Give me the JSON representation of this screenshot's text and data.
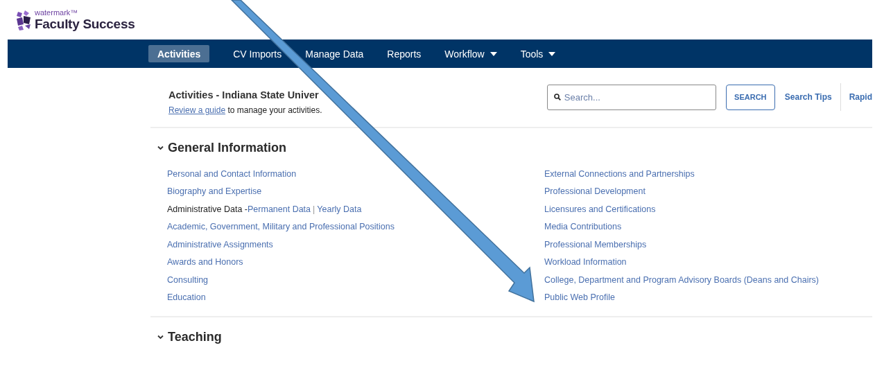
{
  "logo": {
    "brand": "watermark™",
    "product": "Faculty Success"
  },
  "nav": [
    {
      "label": "Activities",
      "selected": true,
      "dropdown": false
    },
    {
      "label": "CV Imports",
      "selected": false,
      "dropdown": false
    },
    {
      "label": "Manage Data",
      "selected": false,
      "dropdown": false
    },
    {
      "label": "Reports",
      "selected": false,
      "dropdown": false
    },
    {
      "label": "Workflow",
      "selected": false,
      "dropdown": true
    },
    {
      "label": "Tools",
      "selected": false,
      "dropdown": true
    }
  ],
  "page": {
    "title": "Activities - Indiana State Univer",
    "guide_link": "Review a guide",
    "guide_text": "to manage your activities."
  },
  "search": {
    "placeholder": "Search...",
    "button": "SEARCH",
    "links": [
      "Search Tips",
      "Rapid"
    ]
  },
  "sections": [
    {
      "title": "General Information",
      "expanded": true,
      "columns": [
        [
          {
            "kind": "link",
            "label": "Personal and Contact Information"
          },
          {
            "kind": "link",
            "label": "Biography and Expertise"
          },
          {
            "kind": "group",
            "label": "Administrative Data -",
            "links": [
              "Permanent Data",
              "Yearly Data"
            ],
            "separator": "|"
          },
          {
            "kind": "link",
            "label": "Academic, Government, Military and Professional Positions"
          },
          {
            "kind": "link",
            "label": "Administrative Assignments"
          },
          {
            "kind": "link",
            "label": "Awards and Honors"
          },
          {
            "kind": "link",
            "label": "Consulting"
          },
          {
            "kind": "link",
            "label": "Education"
          }
        ],
        [
          {
            "kind": "link",
            "label": "External Connections and Partnerships"
          },
          {
            "kind": "link",
            "label": "Professional Development"
          },
          {
            "kind": "link",
            "label": "Licensures and Certifications"
          },
          {
            "kind": "link",
            "label": "Media Contributions"
          },
          {
            "kind": "link",
            "label": "Professional Memberships"
          },
          {
            "kind": "link",
            "label": "Workload Information"
          },
          {
            "kind": "link",
            "label": "College, Department and Program Advisory Boards (Deans and Chairs)"
          },
          {
            "kind": "link",
            "label": "Public Web Profile"
          }
        ]
      ]
    },
    {
      "title": "Teaching",
      "expanded": true
    }
  ]
}
